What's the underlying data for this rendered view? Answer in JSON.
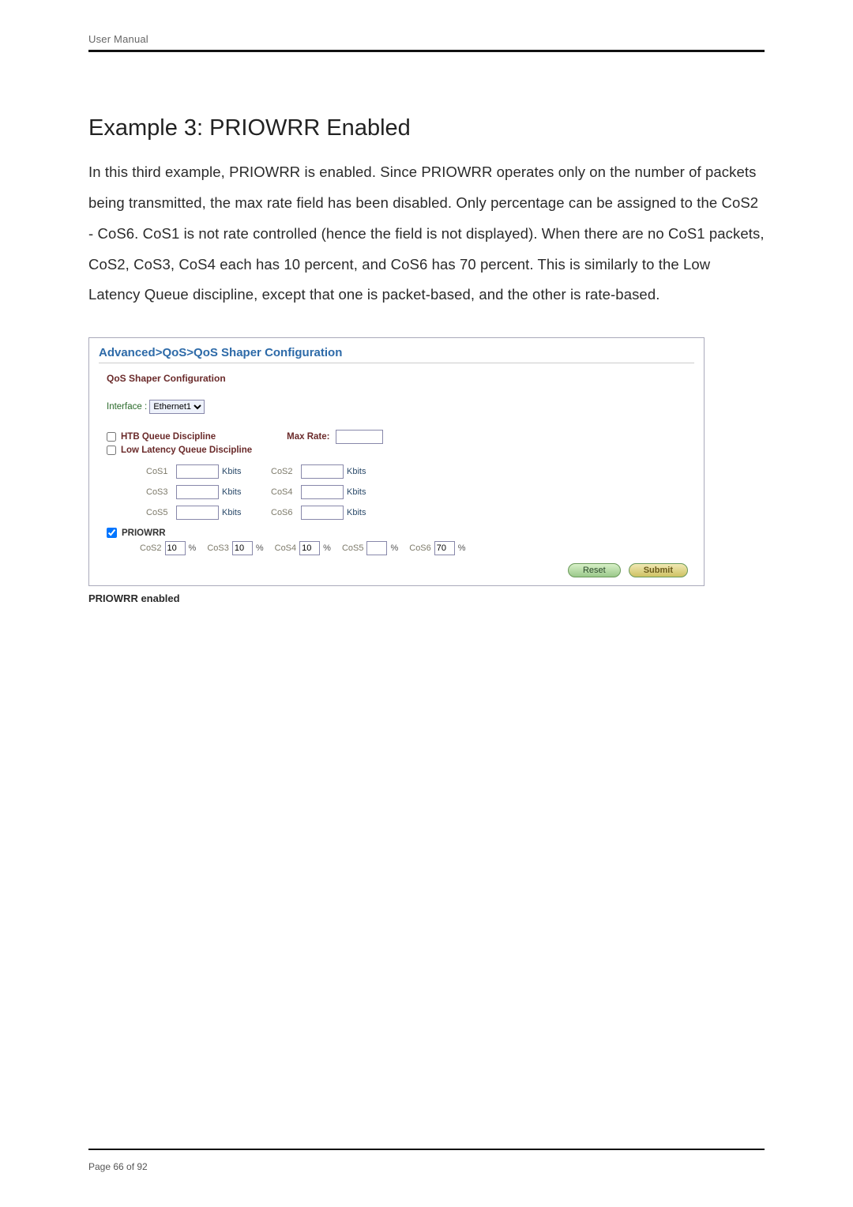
{
  "header": {
    "title": "User Manual"
  },
  "section": {
    "title": "Example 3: PRIOWRR Enabled",
    "body": "In this third example, PRIOWRR is enabled. Since PRIOWRR operates only on the number of packets being transmitted, the max rate field has been disabled. Only percentage can be assigned to the CoS2 - CoS6. CoS1 is not rate controlled (hence the field is not displayed). When there are no CoS1 packets, CoS2, CoS3, CoS4 each has 10 percent, and CoS6 has 70 percent. This is similarly to the Low Latency Queue discipline, except that one is packet-based, and the other is rate-based."
  },
  "panel": {
    "breadcrumb": "Advanced>QoS>QoS Shaper Configuration",
    "subtitle": "QoS Shaper Configuration",
    "interface_label": "Interface :",
    "interface_value": "Ethernet1",
    "htb_label": "HTB Queue Discipline",
    "maxrate_label": "Max Rate:",
    "llq_label": "Low Latency Queue Discipline",
    "cos_unit": "Kbits",
    "cos_rows": [
      {
        "left": "CoS1",
        "right": "CoS2"
      },
      {
        "left": "CoS3",
        "right": "CoS4"
      },
      {
        "left": "CoS5",
        "right": "CoS6"
      }
    ],
    "priowrr_label": "PRIOWRR",
    "priowrr_checked": true,
    "priowrr_items": [
      {
        "label": "CoS2",
        "value": "10"
      },
      {
        "label": "CoS3",
        "value": "10"
      },
      {
        "label": "CoS4",
        "value": "10"
      },
      {
        "label": "CoS5",
        "value": ""
      },
      {
        "label": "CoS6",
        "value": "70"
      }
    ],
    "percent": "%",
    "reset_label": "Reset",
    "submit_label": "Submit"
  },
  "caption": "PRIOWRR enabled",
  "footer": {
    "page": "Page 66 of 92"
  }
}
